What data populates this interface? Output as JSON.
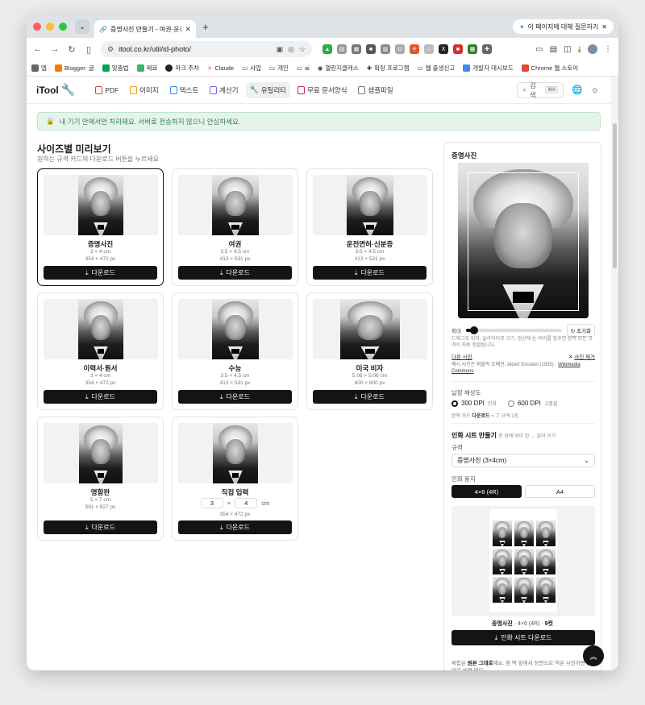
{
  "browser": {
    "tab_title": "증명사진 만들기 - 여권·운전면허·신",
    "ask_button": "이 페이지에 대해 질문하기",
    "url": "itool.co.kr/util/id-photo/",
    "bookmarks": [
      "앱",
      "Blogger: 글",
      "맞춤법",
      "메쿄",
      "파크 주차",
      "Claude",
      "사업",
      "개인",
      "ai",
      "헬린지클래스",
      "확장 프로그램",
      "웹 출생신고",
      "개발자 대시보드",
      "Chrome 웹 스토어"
    ]
  },
  "site": {
    "logo": "iTool",
    "nav": [
      "PDF",
      "이미지",
      "텍스트",
      "계산기",
      "유틸리티",
      "무료 문서양식",
      "샘플파일"
    ],
    "search_label": "검색",
    "search_kbd": "⌘K"
  },
  "notice": "내 기기 안에서만 처리돼요. 서버로 전송하지 않으니 안심하세요.",
  "section": {
    "title": "사이즈별 미리보기",
    "subtitle": "원하는 규격 카드의 다운로드 버튼을 누르세요"
  },
  "cards": [
    {
      "name": "증명사진",
      "dim": "3 × 4 cm",
      "px": "354 × 472 px"
    },
    {
      "name": "여권",
      "dim": "3.5 × 4.5 cm",
      "px": "413 × 531 px"
    },
    {
      "name": "운전면허·신분증",
      "dim": "3.5 × 4.5 cm",
      "px": "413 × 531 px"
    },
    {
      "name": "이력서·원서",
      "dim": "3 × 4 cm",
      "px": "354 × 472 px"
    },
    {
      "name": "수능",
      "dim": "3.5 × 4.5 cm",
      "px": "413 × 531 px"
    },
    {
      "name": "미국 비자",
      "dim": "5.08 × 5.08 cm",
      "px": "600 × 600 px"
    },
    {
      "name": "명함판",
      "dim": "5 × 7 cm",
      "px": "591 × 827 px"
    },
    {
      "name": "직접 입력",
      "w": "3",
      "times": "×",
      "h": "4",
      "unit": "cm",
      "px": "354 × 472 px"
    }
  ],
  "download_label": "다운로드",
  "panel": {
    "title": "증명사진",
    "zoom_label": "확대",
    "zoom_value": 0.04,
    "reset_label": "초기화",
    "hint": "드래그로 위치, 슬라이더로 크기. 정산에 눈·머리를 맞추면 완쪽 모든 규격이 자동 정렬됩니다.",
    "other_photo": "다른 사진",
    "remove_photo": "사진 제거",
    "credit_prefix": "예시 사진은 퍼블릭 도메인. Albert Einstein (1935) · ",
    "credit_link": "Wikimedia Commons",
    "resolution_label": "낱장 해상도",
    "res_300": "300 DPI",
    "res_300_note": "인화",
    "res_600": "600 DPI",
    "res_600_note": "고품질",
    "res_note_prefix": "완쪽 카드 ",
    "res_note_bold": "다운로드",
    "res_note_suffix": " = 그 규격 1장.",
    "sheet_title": "인화 시트 만들기",
    "sheet_title_note": "한 장에 여러 컷 → 잘라 쓰기",
    "spec_label": "규격",
    "spec_value": "증명사진 (3×4cm)",
    "paper_label": "인화 용지",
    "paper_options": [
      "4×6 (4R)",
      "A4"
    ],
    "sheet_caption_name": "증명사진",
    "sheet_caption_paper": " · 4×6 (4R) · ",
    "sheet_caption_count": "9컷",
    "sheet_download": "인화 시트 다운로드",
    "bottom_note_prefix": "체험은 ",
    "bottom_note_bold": "원본 그대로",
    "bottom_note_suffix": "예요. 흰 벽 앞에서 정면으로 찍은 사진이면 그대로 쓰면 돼요."
  }
}
